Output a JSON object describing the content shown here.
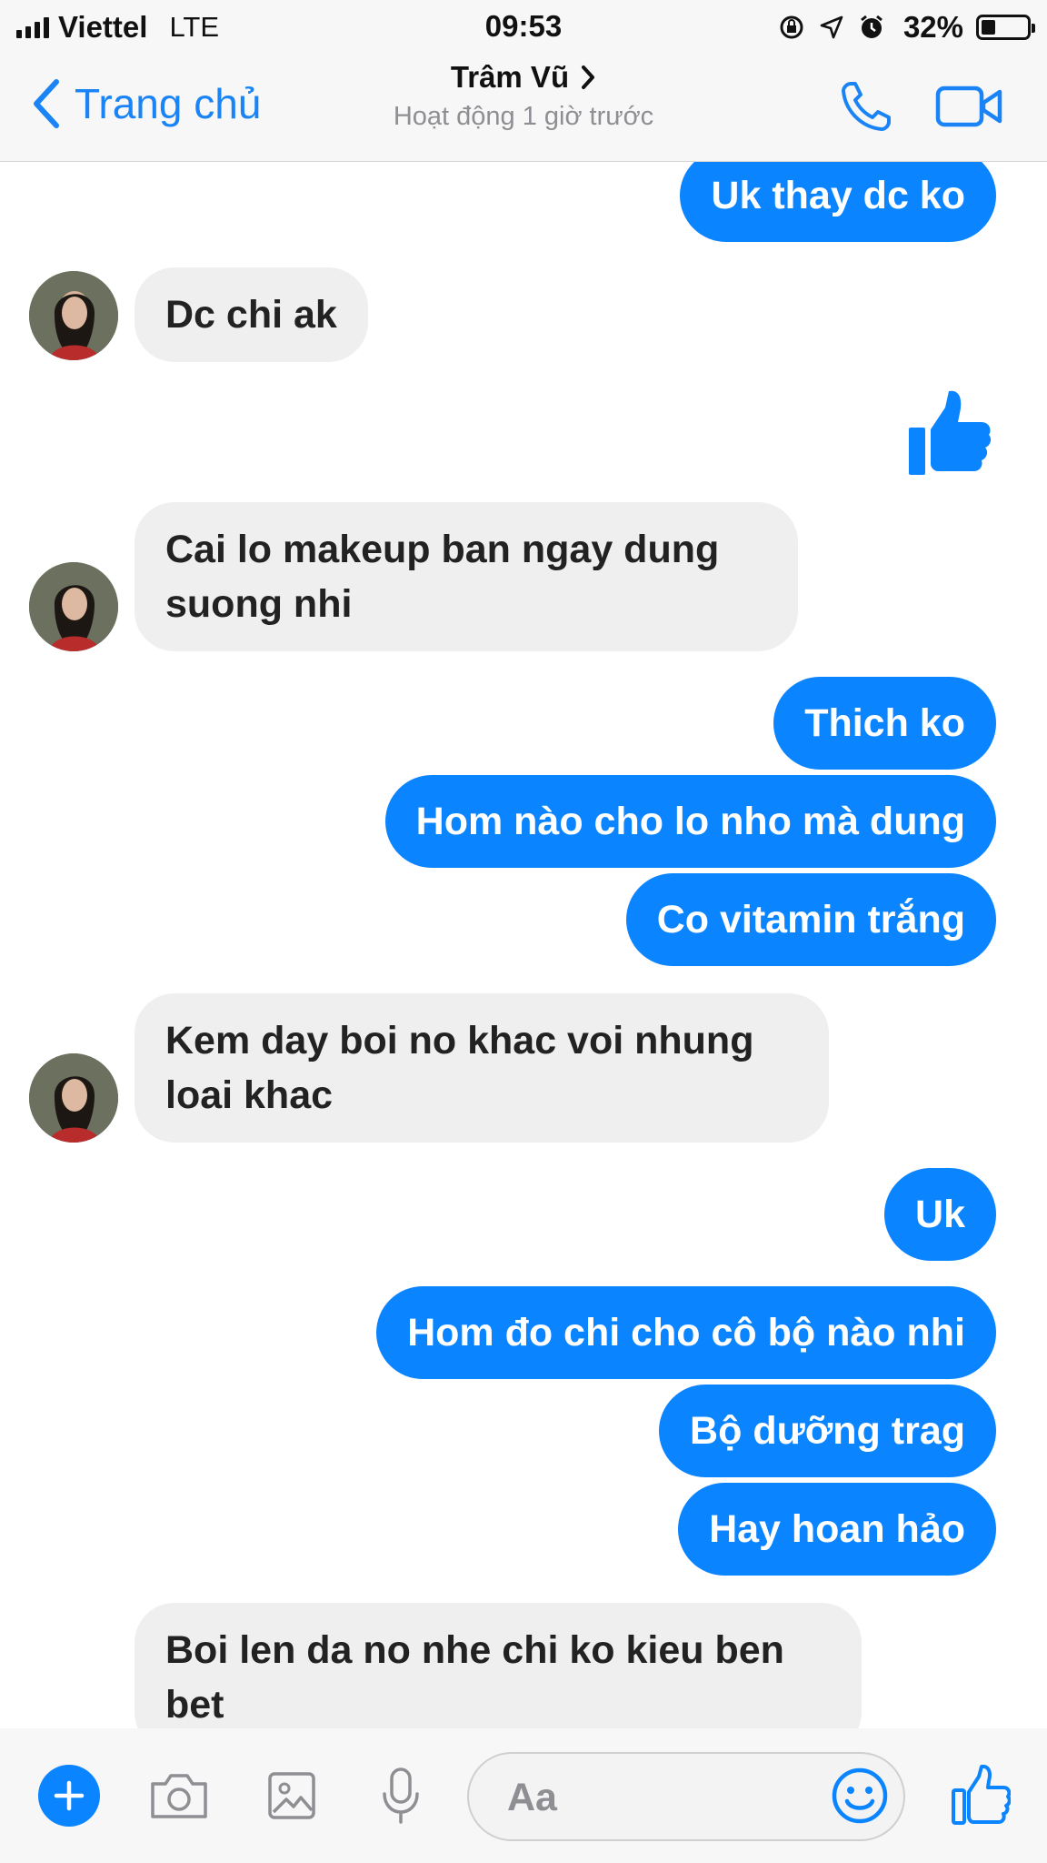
{
  "status_bar": {
    "carrier": "Viettel",
    "network": "LTE",
    "time": "09:53",
    "battery_percent": "32%",
    "battery_level": 0.32,
    "icons": [
      "signal-icon",
      "orientation-lock-icon",
      "location-icon",
      "alarm-icon",
      "battery-icon"
    ]
  },
  "nav": {
    "back_label": "Trang chủ",
    "contact_name": "Trâm Vũ",
    "status": "Hoạt động 1 giờ trước",
    "icons": [
      "back-chevron-icon",
      "chevron-right-icon",
      "phone-icon",
      "video-icon"
    ]
  },
  "messages": [
    {
      "side": "out",
      "text": "Uk thay dc ko"
    },
    {
      "side": "in",
      "text": "Dc chi ak"
    },
    {
      "side": "out",
      "type": "like"
    },
    {
      "side": "in",
      "text": "Cai lo makeup ban ngay dung suong nhi"
    },
    {
      "side": "out",
      "text": "Thich ko"
    },
    {
      "side": "out",
      "text": "Hom nào cho lo nho mà dung"
    },
    {
      "side": "out",
      "text": "Co vitamin trắng"
    },
    {
      "side": "in",
      "text": "Kem day boi no khac voi nhung loai khac"
    },
    {
      "side": "out",
      "text": "Uk"
    },
    {
      "side": "out",
      "text": "Hom đo chi cho cô bộ nào nhi"
    },
    {
      "side": "out",
      "text": "Bộ dưỡng trag"
    },
    {
      "side": "out",
      "text": "Hay hoan hảo"
    },
    {
      "side": "in",
      "text": "Boi len da no nhe chi ko kieu ben bet"
    }
  ],
  "composer": {
    "placeholder": "Aa",
    "icons": [
      "plus-icon",
      "camera-icon",
      "image-icon",
      "microphone-icon",
      "emoji-icon",
      "thumbs-up-icon"
    ]
  },
  "colors": {
    "accent": "#0a84ff",
    "incoming_bubble": "#efefef",
    "bar_background": "#f7f7f7"
  }
}
